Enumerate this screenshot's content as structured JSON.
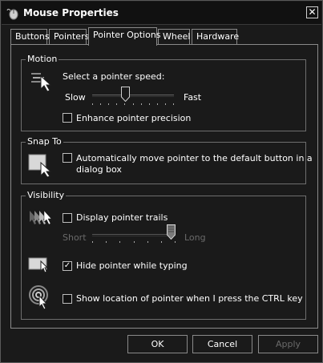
{
  "window": {
    "title": "Mouse Properties",
    "close_glyph": "✕"
  },
  "tabs": [
    {
      "label": "Buttons"
    },
    {
      "label": "Pointers"
    },
    {
      "label": "Pointer Options"
    },
    {
      "label": "Wheel"
    },
    {
      "label": "Hardware"
    }
  ],
  "motion": {
    "legend": "Motion",
    "prompt": "Select a pointer speed:",
    "slow_label": "Slow",
    "fast_label": "Fast",
    "speed_level": 0.4,
    "enhance_label": "Enhance pointer precision",
    "enhance_checked": false
  },
  "snap": {
    "legend": "Snap To",
    "label_line1": "Automatically move pointer to the default button in a",
    "label_line2": "dialog box",
    "checked": false
  },
  "visibility": {
    "legend": "Visibility",
    "trails_label": "Display pointer trails",
    "trails_checked": false,
    "short_label": "Short",
    "long_label": "Long",
    "trail_level": 1.0,
    "hide_label": "Hide pointer while typing",
    "hide_checked": true,
    "ctrl_label": "Show location of pointer when I press the CTRL key",
    "ctrl_checked": false
  },
  "buttons": {
    "ok": "OK",
    "cancel": "Cancel",
    "apply": "Apply"
  },
  "icons": {
    "title": "mouse-icon",
    "motion": "pointer-speed-icon",
    "snap": "snap-to-icon",
    "trails": "pointer-trails-icon",
    "hide": "hide-pointer-icon",
    "ctrl": "pointer-location-icon"
  }
}
